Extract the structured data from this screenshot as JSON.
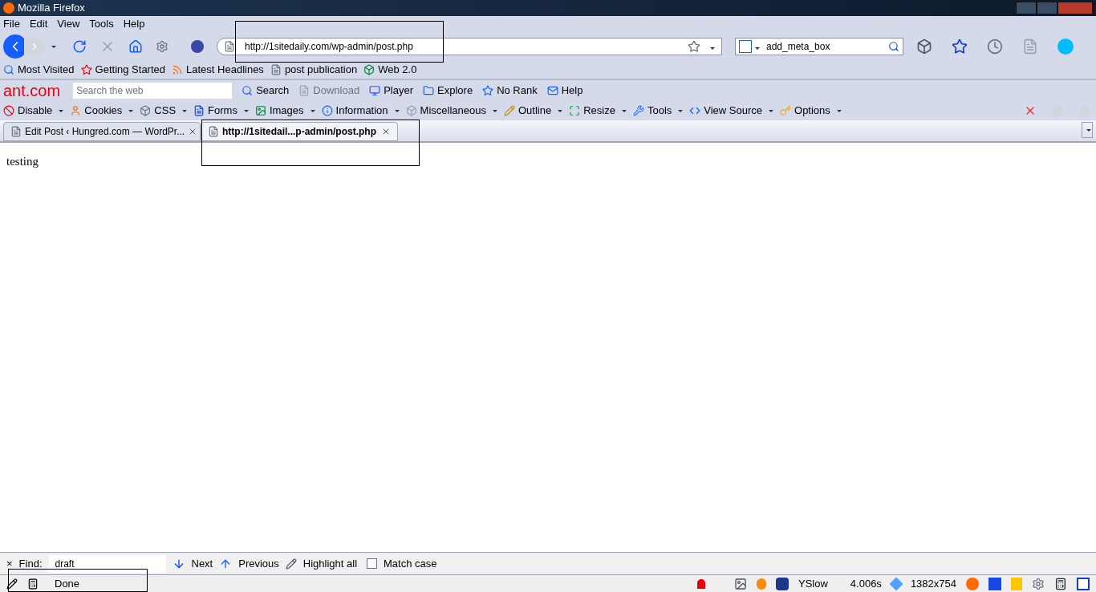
{
  "window": {
    "title": "Mozilla Firefox"
  },
  "menu": [
    "File",
    "Edit",
    "View",
    "Tools",
    "Help"
  ],
  "nav": {
    "url": "http://1sitedaily.com/wp-admin/post.php",
    "search_value": "add_meta_box",
    "forward_disabled": true,
    "stop_disabled": true
  },
  "bookmarks": [
    "Most Visited",
    "Getting Started",
    "Latest Headlines",
    "post publication",
    "Web 2.0"
  ],
  "ant_toolbar": {
    "logo": "ant.com",
    "search_placeholder": "Search the web",
    "items": [
      {
        "label": "Search",
        "disabled": false
      },
      {
        "label": "Download",
        "disabled": true
      },
      {
        "label": "Player",
        "disabled": false
      },
      {
        "label": "Explore",
        "disabled": false
      },
      {
        "label": "No Rank",
        "disabled": false
      },
      {
        "label": "Help",
        "disabled": false
      }
    ]
  },
  "webdev_toolbar": [
    "Disable",
    "Cookies",
    "CSS",
    "Forms",
    "Images",
    "Information",
    "Miscellaneous",
    "Outline",
    "Resize",
    "Tools",
    "View Source",
    "Options"
  ],
  "tabs": [
    {
      "label": "Edit Post ‹ Hungred.com — WordPr...",
      "selected": false
    },
    {
      "label": "http://1sitedail...p-admin/post.php",
      "selected": true
    }
  ],
  "page": {
    "text": "testing"
  },
  "find_bar": {
    "close": "×",
    "label": "Find:",
    "value": "draft",
    "next": "Next",
    "previous": "Previous",
    "highlight_all": "Highlight all",
    "match_case": {
      "label": "Match case",
      "checked": false
    }
  },
  "status_bar": {
    "status": "Done",
    "yslow": "YSlow",
    "time": "4.006s",
    "size": "1382x754"
  }
}
